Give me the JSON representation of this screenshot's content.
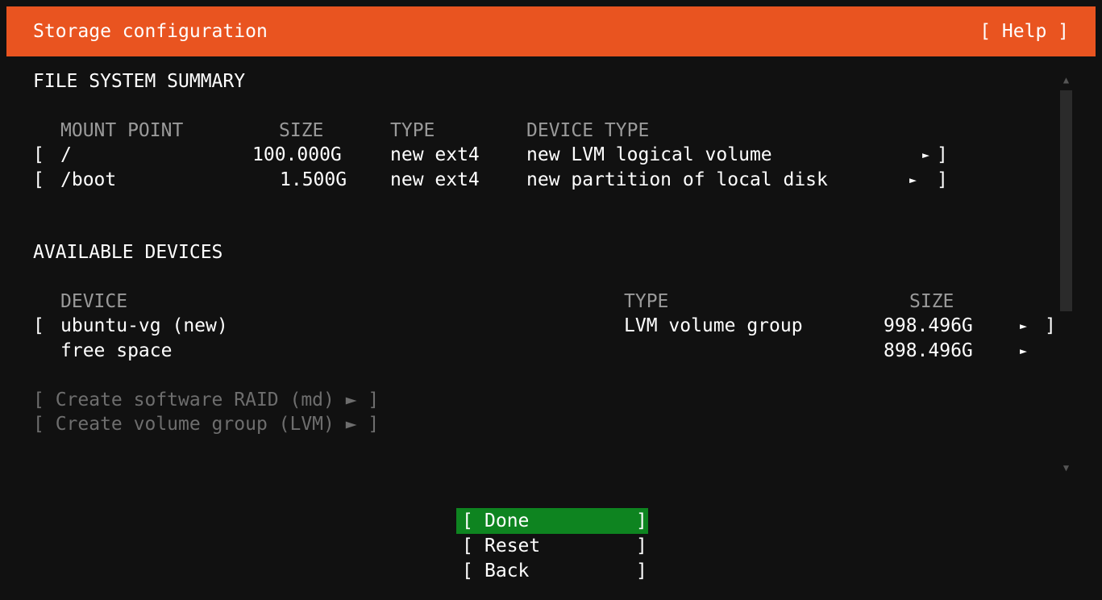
{
  "header": {
    "title": "Storage configuration",
    "help_label": "[ Help ]"
  },
  "filesystem_summary": {
    "heading": "FILE SYSTEM SUMMARY",
    "columns": {
      "mount_point": "MOUNT POINT",
      "size": "SIZE",
      "type": "TYPE",
      "device_type": "DEVICE TYPE"
    },
    "rows": [
      {
        "open": "[",
        "mount": "/",
        "size": "100.000G",
        "type": "new ext4",
        "device_type": "new LVM logical volume",
        "arrow": "►",
        "close": "]"
      },
      {
        "open": "[",
        "mount": "/boot",
        "size": "1.500G",
        "type": "new ext4",
        "device_type": "new partition of local disk",
        "arrow": "►",
        "close": "]"
      }
    ]
  },
  "available_devices": {
    "heading": "AVAILABLE DEVICES",
    "columns": {
      "device": "DEVICE",
      "type": "TYPE",
      "size": "SIZE"
    },
    "rows": [
      {
        "open": "[",
        "device": "ubuntu-vg (new)",
        "type": "LVM volume group",
        "size": "998.496G",
        "arrow": "►",
        "close": "]"
      },
      {
        "open": "",
        "device": "free space",
        "type": "",
        "size": "898.496G",
        "arrow": "►",
        "close": ""
      }
    ],
    "actions": [
      "[ Create software RAID (md) ► ]",
      "[ Create volume group (LVM) ► ]"
    ]
  },
  "scroll": {
    "up_arrow": "▲",
    "down_arrow": "▼"
  },
  "buttons": {
    "done": {
      "open": "[",
      "label": "Done",
      "close": "]"
    },
    "reset": {
      "open": "[",
      "label": "Reset",
      "close": "]"
    },
    "back": {
      "open": "[",
      "label": "Back",
      "close": "]"
    }
  },
  "colors": {
    "header_bg": "#e95420",
    "focused_button_bg": "#0e8420",
    "background": "#111111"
  }
}
